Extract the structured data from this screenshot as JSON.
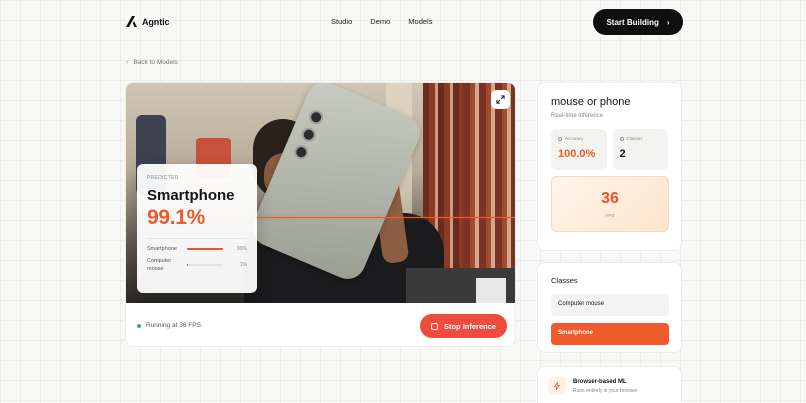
{
  "header": {
    "brand": "Agntic",
    "nav": [
      "Studio",
      "Demo",
      "Models"
    ],
    "cta_label": "Start Building"
  },
  "back_label": "Back to Models",
  "prediction": {
    "label": "PREDICTED",
    "class": "Smartphone",
    "confidence": "99.1%",
    "bars": [
      {
        "name": "Smartphone",
        "value": "99%",
        "fraction": 0.99
      },
      {
        "name": "Computer mouse",
        "value": "1%",
        "fraction": 0.01
      }
    ]
  },
  "status_text": "Running at 36 FPS",
  "stop_label": "Stop Inference",
  "model": {
    "title": "mouse or phone",
    "subtitle": "Real-time inference",
    "accuracy_label": "Accuracy",
    "accuracy_value": "100.0%",
    "classes_label": "Classes",
    "classes_value": "2",
    "fps_value": "36",
    "fps_label": "FPS"
  },
  "classes_panel": {
    "title": "Classes",
    "items": [
      "Computer mouse",
      "Smartphone"
    ],
    "active_index": 1
  },
  "browser_card": {
    "title": "Browser-based ML",
    "subtitle": "Runs entirely in your browser"
  },
  "colors": {
    "accent": "#ee5b2b",
    "stop": "#f04b3f",
    "status_dot": "#2fb56a"
  }
}
